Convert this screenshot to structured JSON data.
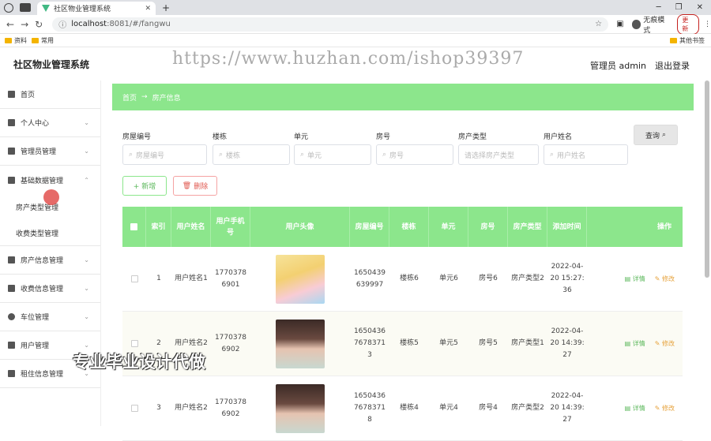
{
  "browser": {
    "tab_title": "社区物业管理系统",
    "url_host": "localhost",
    "url_rest": ":8081/#/fangwu",
    "incognito_label": "无痕模式",
    "update_label": "更新",
    "bookmarks": [
      "资料",
      "常用"
    ],
    "bookmarks_right": "其他书签"
  },
  "header": {
    "title": "社区物业管理系统",
    "watermark": "https://www.huzhan.com/ishop39397",
    "user": "管理员 admin",
    "logout": "退出登录"
  },
  "sidebar": {
    "items": [
      {
        "label": "首页",
        "icon": "home-icon"
      },
      {
        "label": "个人中心",
        "icon": "user-icon"
      },
      {
        "label": "管理员管理",
        "icon": "admin-icon"
      },
      {
        "label": "基础数据管理",
        "icon": "list-icon"
      },
      {
        "label": "房产信息管理",
        "icon": "grid-icon"
      },
      {
        "label": "收费信息管理",
        "icon": "fee-icon"
      },
      {
        "label": "车位管理",
        "icon": "clock-icon"
      },
      {
        "label": "用户管理",
        "icon": "users-icon"
      },
      {
        "label": "租住信息管理",
        "icon": "monitor-icon"
      }
    ],
    "submenu": [
      "房产类型管理",
      "收费类型管理"
    ]
  },
  "breadcrumb": {
    "home": "首页",
    "arrow": "→",
    "current": "房产信息"
  },
  "filters": {
    "labels": [
      "房屋编号",
      "楼栋",
      "单元",
      "房号",
      "房产类型",
      "用户姓名"
    ],
    "placeholders": [
      "房屋编号",
      "楼栋",
      "单元",
      "房号",
      "请选择房产类型",
      "用户姓名"
    ],
    "query": "查询"
  },
  "actions": {
    "add": "+ 新增",
    "delete": "删除"
  },
  "table": {
    "headers": [
      "索引",
      "用户姓名",
      "用户手机号",
      "用户头像",
      "房屋编号",
      "楼栋",
      "单元",
      "房号",
      "房产类型",
      "添加时间",
      "操作"
    ],
    "rows": [
      {
        "index": "1",
        "name": "用户姓名1",
        "phone": "17703786901",
        "house_no": "1650439639997",
        "building": "楼栋6",
        "unit": "单元6",
        "room": "房号6",
        "type": "房产类型2",
        "time": "2022-04-20 15:27:36"
      },
      {
        "index": "2",
        "name": "用户姓名2",
        "phone": "17703786902",
        "house_no": "16504367678371 3",
        "building": "楼栋5",
        "unit": "单元5",
        "room": "房号5",
        "type": "房产类型1",
        "time": "2022-04-20 14:39:27"
      },
      {
        "index": "3",
        "name": "用户姓名2",
        "phone": "17703786902",
        "house_no": "16504367678371 8",
        "building": "楼栋4",
        "unit": "单元4",
        "room": "房号4",
        "type": "房产类型2",
        "time": "2022-04-20 14:39:27"
      }
    ],
    "op_detail": "详情",
    "op_edit": "修改"
  },
  "overlay": "专业毕业设计代做"
}
